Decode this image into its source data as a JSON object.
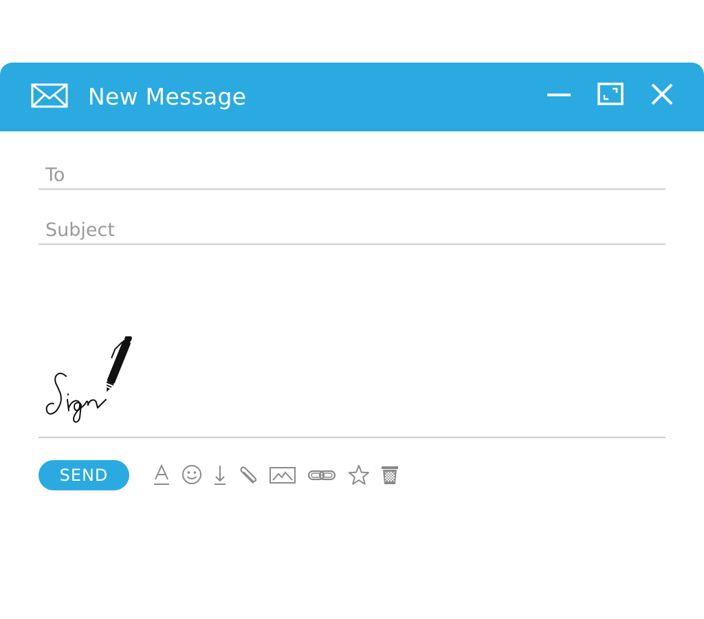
{
  "window": {
    "title": "New Message",
    "accent_color": "#2aaae1",
    "title_icon": "mail-icon",
    "controls": [
      "minimize-icon",
      "maximize-icon",
      "close-icon"
    ]
  },
  "fields": {
    "to": {
      "value": "",
      "placeholder": "To"
    },
    "subject": {
      "value": "",
      "placeholder": "Subject"
    }
  },
  "body": {
    "signature_text": "Sign",
    "signature_icon": "pen-icon"
  },
  "toolbar": {
    "send_label": "SEND",
    "tools": [
      "text-format-icon",
      "emoji-icon",
      "download-icon",
      "attachment-icon",
      "image-icon",
      "link-icon",
      "star-icon",
      "trash-icon"
    ]
  }
}
